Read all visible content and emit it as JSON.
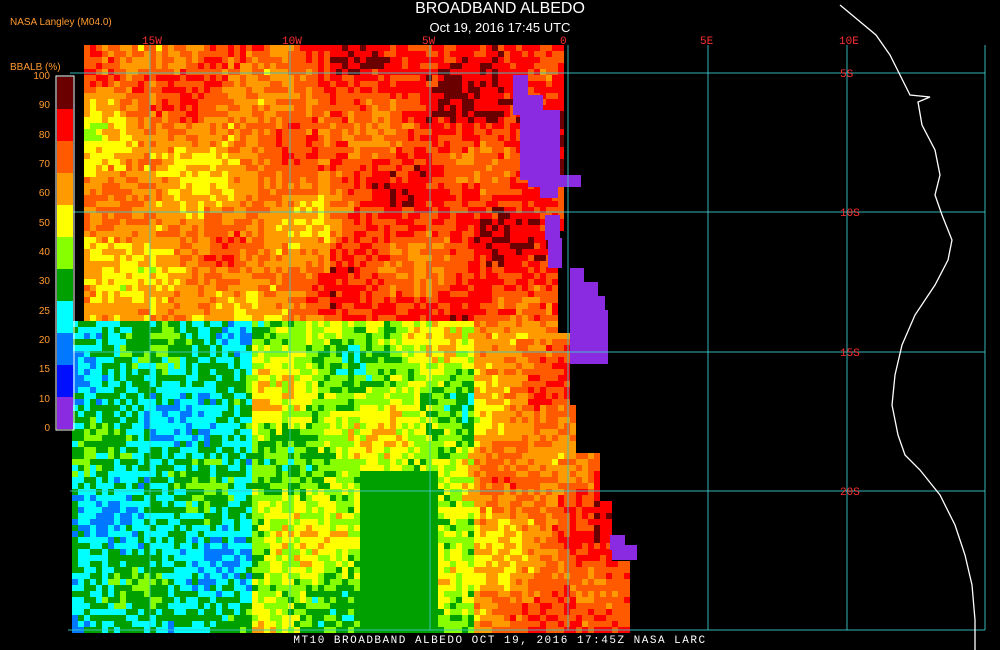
{
  "title": "BROADBAND ALBEDO",
  "subtitle": "Oct 19, 2016 17:45 UTC",
  "producer": "NASA Langley (M04.0)",
  "footer": "MT10  BROADBAND ALBEDO   OCT 19, 2016 17:45Z   NASA LARC",
  "colorbar": {
    "title": "BBALB (%)",
    "labels": [
      "100",
      "90",
      "80",
      "70",
      "60",
      "50",
      "40",
      "30",
      "25",
      "20",
      "15",
      "10",
      "0"
    ],
    "colors": [
      "#6a0000",
      "#ff0000",
      "#ff5a00",
      "#ff9a00",
      "#ffff00",
      "#88ff00",
      "#00a000",
      "#00ffff",
      "#0078ff",
      "#0010ff",
      "#8a2be2"
    ]
  },
  "gridlines": {
    "longitudes": [
      "15W",
      "10W",
      "5W",
      "0",
      "5E",
      "10E"
    ],
    "latitudes": [
      "5S",
      "10S",
      "15S",
      "20S"
    ]
  },
  "colors": {
    "grid": "#3cc8c8",
    "grid_label": "#ff3030",
    "coast": "#ffffff",
    "no_data": "#000000",
    "clear_ocean": "#8a2be2"
  }
}
